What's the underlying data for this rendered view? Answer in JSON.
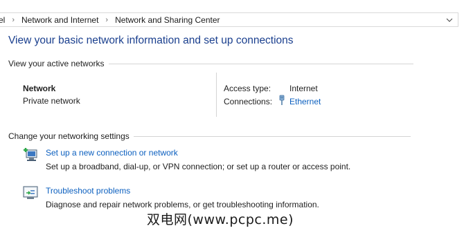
{
  "breadcrumb": {
    "items": [
      "el",
      "Network and Internet",
      "Network and Sharing Center"
    ],
    "separator": "›"
  },
  "page": {
    "title": "View your basic network information and set up connections"
  },
  "active_networks": {
    "heading": "View your active networks",
    "network_name": "Network",
    "network_category": "Private network",
    "access_type_label": "Access type:",
    "access_type_value": "Internet",
    "connections_label": "Connections:",
    "connections_value": "Ethernet"
  },
  "settings": {
    "heading": "Change your networking settings",
    "tasks": [
      {
        "icon": "new-connection-icon",
        "link": "Set up a new connection or network",
        "description": "Set up a broadband, dial-up, or VPN connection; or set up a router or access point."
      },
      {
        "icon": "troubleshoot-icon",
        "link": "Troubleshoot problems",
        "description": "Diagnose and repair network problems, or get troubleshooting information."
      }
    ]
  },
  "watermark": "双电网(www.pcpc.me)",
  "colors": {
    "title": "#1a3f8e",
    "link": "#0b5fbf",
    "divider": "#d4d4d4"
  }
}
